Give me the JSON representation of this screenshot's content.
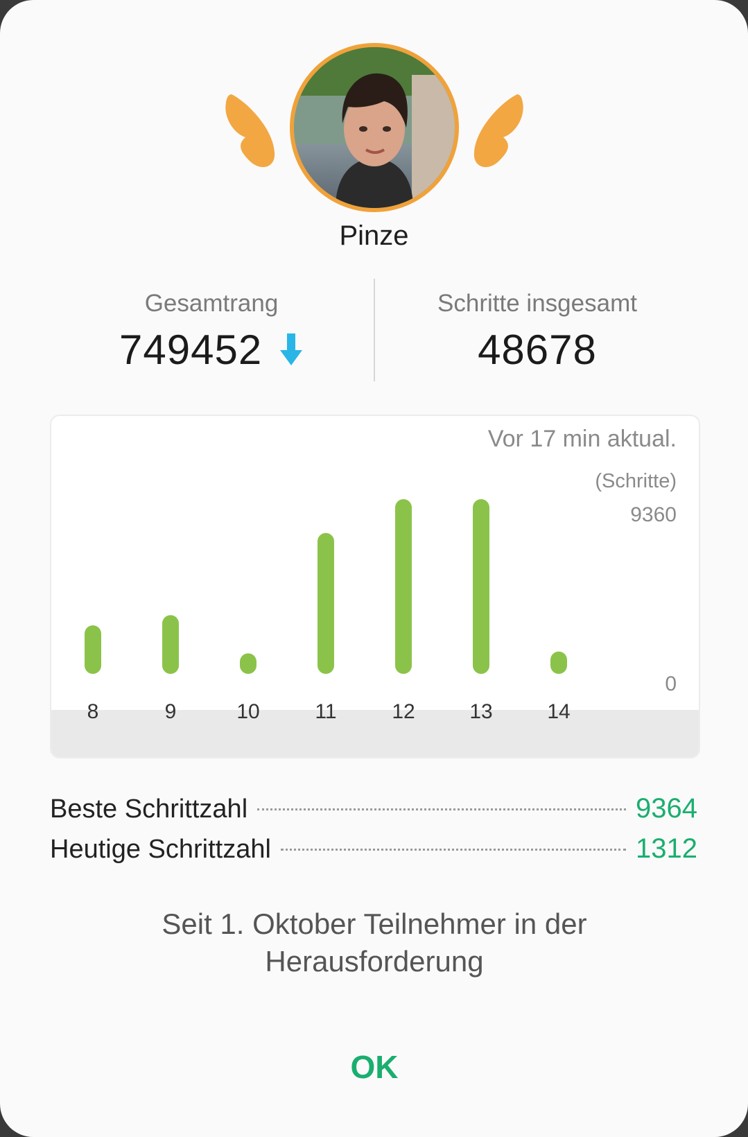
{
  "profile": {
    "name": "Pinze"
  },
  "stats": {
    "rank_label": "Gesamtrang",
    "rank_value": "749452",
    "steps_label": "Schritte insgesamt",
    "steps_value": "48678"
  },
  "chart_data": {
    "type": "bar",
    "updated_text": "Vor 17 min aktual.",
    "ylabel": "(Schritte)",
    "ylim": [
      0,
      9360
    ],
    "ytick_labels": [
      "9360",
      "0"
    ],
    "categories": [
      "8",
      "9",
      "10",
      "11",
      "12",
      "13",
      "14"
    ],
    "values": [
      2600,
      3150,
      1100,
      7550,
      9360,
      9360,
      1200
    ],
    "bar_color": "#8bc34a",
    "grid": false
  },
  "summary": {
    "best_label": "Beste Schrittzahl",
    "best_value": "9364",
    "today_label": "Heutige Schrittzahl",
    "today_value": "1312"
  },
  "info_text": "Seit 1. Oktober Teilnehmer in der Herausforderung",
  "ok_label": "OK",
  "colors": {
    "accent": "#1aae6f",
    "rank_down": "#29b6e6",
    "avatar_ring": "#f0a23a"
  }
}
